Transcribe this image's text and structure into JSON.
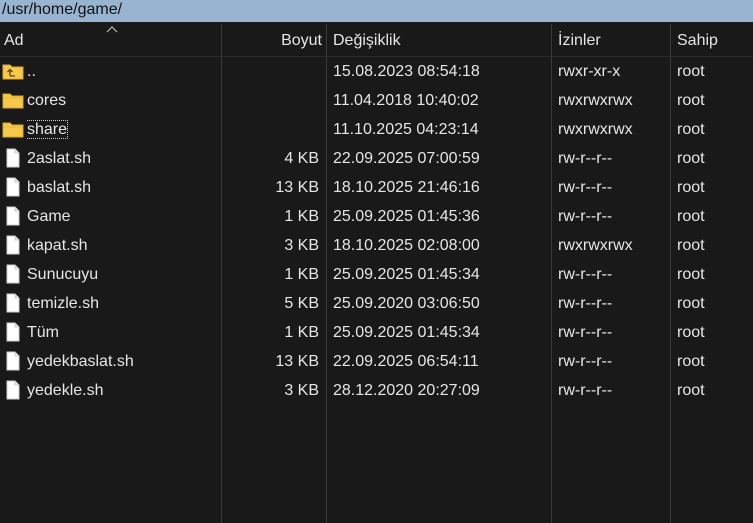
{
  "path": "/usr/home/game/",
  "columns": {
    "name": "Ad",
    "size": "Boyut",
    "modified": "Değişiklik",
    "permissions": "İzinler",
    "owner": "Sahip"
  },
  "colors": {
    "path_bar": "#99b4d1",
    "background": "#191919",
    "folder": "#f6c94b",
    "file": "#ffffff",
    "text": "#e6e6e6"
  },
  "files": [
    {
      "name": "..",
      "icon": "parent-folder-icon",
      "size": "",
      "modified": "15.08.2023 08:54:18",
      "permissions": "rwxr-xr-x",
      "owner": "root"
    },
    {
      "name": "cores",
      "icon": "folder-icon",
      "size": "",
      "modified": "11.04.2018 10:40:02",
      "permissions": "rwxrwxrwx",
      "owner": "root"
    },
    {
      "name": "share",
      "icon": "folder-icon",
      "size": "",
      "modified": "11.10.2025 04:23:14",
      "permissions": "rwxrwxrwx",
      "owner": "root",
      "focused": true
    },
    {
      "name": "2aslat.sh",
      "icon": "file-icon",
      "size": "4 KB",
      "modified": "22.09.2025 07:00:59",
      "permissions": "rw-r--r--",
      "owner": "root"
    },
    {
      "name": "baslat.sh",
      "icon": "file-icon",
      "size": "13 KB",
      "modified": "18.10.2025 21:46:16",
      "permissions": "rw-r--r--",
      "owner": "root"
    },
    {
      "name": "Game",
      "icon": "file-icon",
      "size": "1 KB",
      "modified": "25.09.2025 01:45:36",
      "permissions": "rw-r--r--",
      "owner": "root"
    },
    {
      "name": "kapat.sh",
      "icon": "file-icon",
      "size": "3 KB",
      "modified": "18.10.2025 02:08:00",
      "permissions": "rwxrwxrwx",
      "owner": "root"
    },
    {
      "name": "Sunucuyu",
      "icon": "file-icon",
      "size": "1 KB",
      "modified": "25.09.2025 01:45:34",
      "permissions": "rw-r--r--",
      "owner": "root"
    },
    {
      "name": "temizle.sh",
      "icon": "file-icon",
      "size": "5 KB",
      "modified": "25.09.2020 03:06:50",
      "permissions": "rw-r--r--",
      "owner": "root"
    },
    {
      "name": "Tüm",
      "icon": "file-icon",
      "size": "1 KB",
      "modified": "25.09.2025 01:45:34",
      "permissions": "rw-r--r--",
      "owner": "root"
    },
    {
      "name": "yedekbaslat.sh",
      "icon": "file-icon",
      "size": "13 KB",
      "modified": "22.09.2025 06:54:11",
      "permissions": "rw-r--r--",
      "owner": "root"
    },
    {
      "name": "yedekle.sh",
      "icon": "file-icon",
      "size": "3 KB",
      "modified": "28.12.2020 20:27:09",
      "permissions": "rw-r--r--",
      "owner": "root"
    }
  ]
}
